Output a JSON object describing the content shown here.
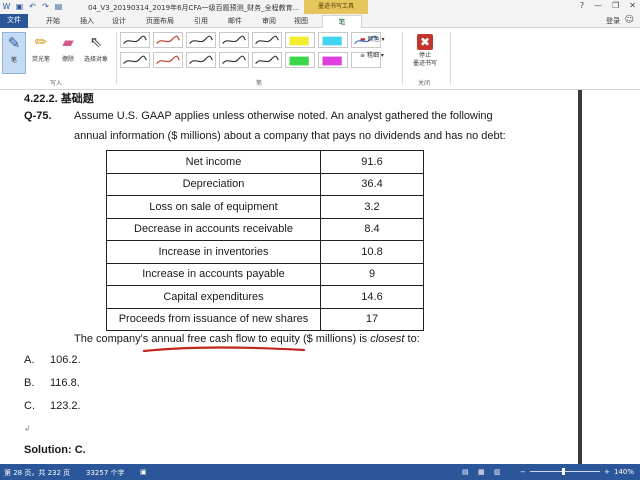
{
  "window": {
    "title": "04_V3_20190314_2019年6月CFA一级百题预测_财务_全程教育...",
    "context_tab_header": "墨迹书写工具",
    "minimize": "—",
    "restore": "❐",
    "close": "✕"
  },
  "tabs": [
    {
      "label": "文件"
    },
    {
      "label": "开始"
    },
    {
      "label": "插入"
    },
    {
      "label": "设计"
    },
    {
      "label": "页面布局"
    },
    {
      "label": "引用"
    },
    {
      "label": "邮件"
    },
    {
      "label": "审阅"
    },
    {
      "label": "视图"
    },
    {
      "label": "笔"
    }
  ],
  "account": {
    "login_label": "登录"
  },
  "ribbon": {
    "write_group": {
      "label": "写入",
      "buttons": [
        {
          "label": "笔",
          "icon": "pen-icon"
        },
        {
          "label": "荧光笔",
          "icon": "highlighter-icon"
        },
        {
          "label": "擦除",
          "icon": "eraser-icon"
        },
        {
          "label": "选择对象",
          "icon": "select-arrow-icon"
        }
      ]
    },
    "pens_group": {
      "label": "笔",
      "colors": [
        "#333333",
        "#c0392b",
        "#333333",
        "#333333",
        "#333333",
        "#f2ee2f",
        "#3fd5f0",
        "#2b73d6",
        "#333333",
        "#c0392b",
        "#333333",
        "#333333",
        "#333333",
        "#39d84a",
        "#e03de0",
        "#ffffff"
      ],
      "color_option": "颜色",
      "thickness_option": "粗细"
    },
    "close_group": {
      "label": "关闭",
      "stop_label_1": "停止",
      "stop_label_2": "墨迹书写"
    }
  },
  "document": {
    "section_heading": "4.22.2.  基础题",
    "question_number": "Q-75.",
    "question_line1": "Assume U.S. GAAP applies unless otherwise noted. An analyst gathered the following",
    "question_line2": "annual information ($ millions) about a company that pays no dividends and has no debt:",
    "table": [
      {
        "label": "Net income",
        "value": "91.6"
      },
      {
        "label": "Depreciation",
        "value": "36.4"
      },
      {
        "label": "Loss on sale of equipment",
        "value": "3.2"
      },
      {
        "label": "Decrease in accounts receivable",
        "value": "8.4"
      },
      {
        "label": "Increase in inventories",
        "value": "10.8"
      },
      {
        "label": "Increase in accounts payable",
        "value": "9"
      },
      {
        "label": "Capital expenditures",
        "value": "14.6"
      },
      {
        "label": "Proceeds from issuance of new shares",
        "value": "17"
      }
    ],
    "ask_prefix": "The company's ",
    "ask_highlight": "annual free cash flow to equity",
    "ask_mid": " ($ millions) is ",
    "ask_italic": "closest",
    "ask_suffix": " to:",
    "options": [
      {
        "letter": "A.",
        "value": "106.2."
      },
      {
        "letter": "B.",
        "value": "116.8."
      },
      {
        "letter": "C.",
        "value": "123.2."
      }
    ],
    "solution": "Solution: C.",
    "ink_color": "#c0281e"
  },
  "status": {
    "page": "第 28 页，共 232 页",
    "words": "33257 个字",
    "zoom": "140%",
    "zoom_minus": "−",
    "zoom_plus": "+",
    "zoom_level": 0.45
  }
}
